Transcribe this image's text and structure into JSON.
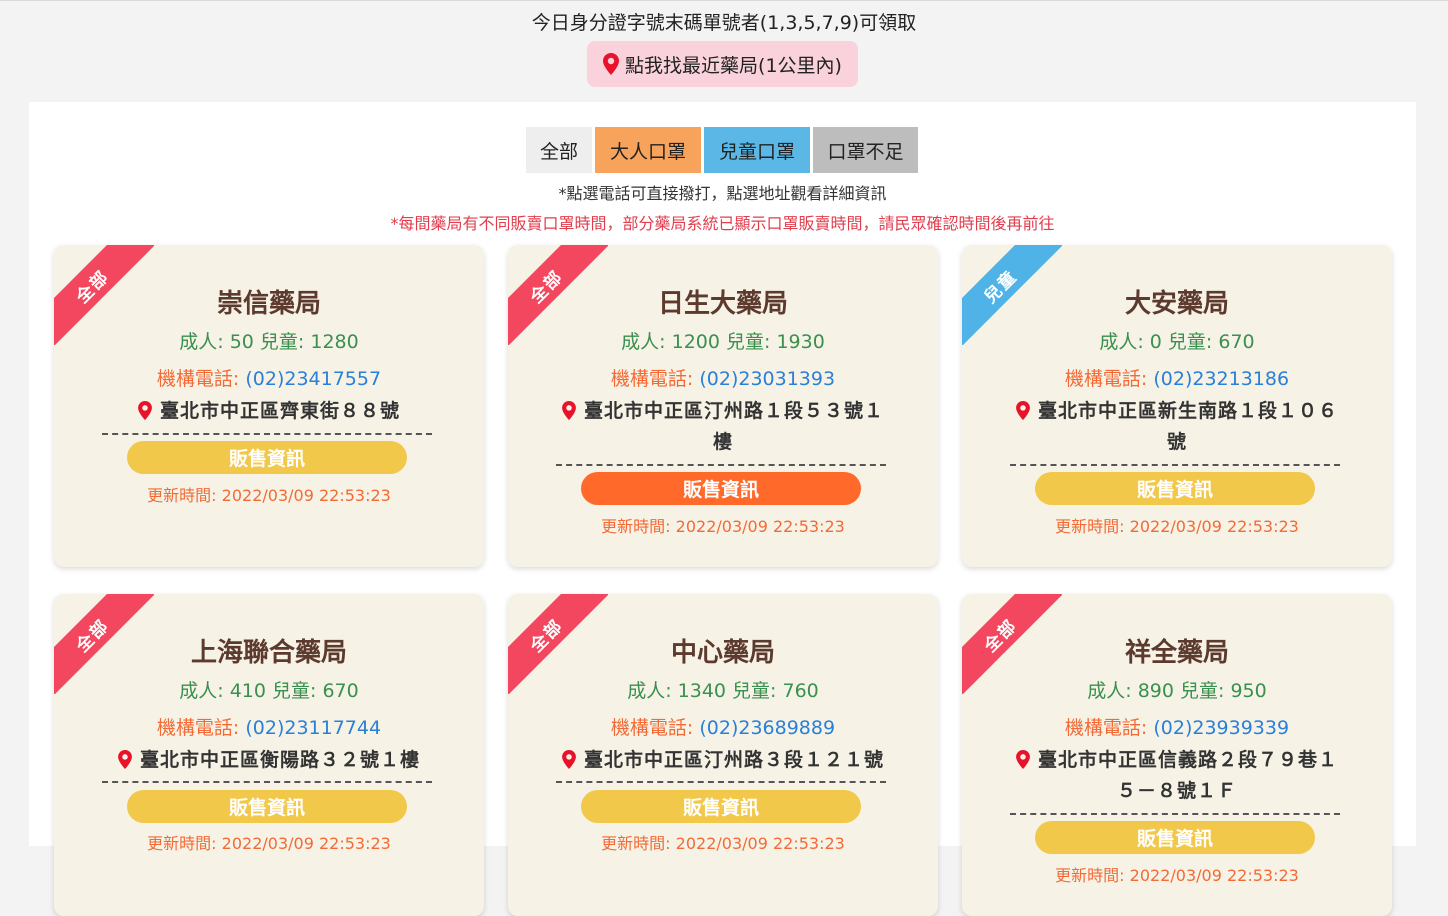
{
  "header": {
    "notice": "今日身分證字號末碼單號者(1,3,5,7,9)可領取",
    "locate_button": "點我找最近藥局(1公里內)"
  },
  "filters": [
    "全部",
    "大人口罩",
    "兒童口罩",
    "口罩不足"
  ],
  "hints": {
    "line1": "*點選電話可直接撥打，點選地址觀看詳細資訊",
    "line2": "*每間藥局有不同販賣口罩時間，部分藥局系統已顯示口罩販賣時間，請民眾確認時間後再前往"
  },
  "labels": {
    "phone_label": "機構電話: ",
    "sale_button": "販售資訊",
    "update_prefix": "更新時間: "
  },
  "colors": {
    "ribbon_all": "#f2475f",
    "ribbon_child": "#4fb3e8",
    "sale_yellow": "#f2c84b",
    "sale_orange": "#ff6a2b"
  },
  "pharmacies": [
    {
      "ribbon": "全部",
      "name": "崇信藥局",
      "stock": "成人: 50 兒童: 1280",
      "phone": "(02)23417557",
      "address": "臺北市中正區齊東街８８號",
      "updated": "更新時間: 2022/03/09 22:53:23"
    },
    {
      "ribbon": "全部",
      "name": "日生大藥局",
      "stock": "成人: 1200 兒童: 1930",
      "phone": "(02)23031393",
      "address": "臺北市中正區汀州路１段５３號１樓",
      "updated": "更新時間: 2022/03/09 22:53:23"
    },
    {
      "ribbon": "兒童",
      "name": "大安藥局",
      "stock": "成人: 0 兒童: 670",
      "phone": "(02)23213186",
      "address": "臺北市中正區新生南路１段１０６號",
      "updated": "更新時間: 2022/03/09 22:53:23"
    },
    {
      "ribbon": "全部",
      "name": "上海聯合藥局",
      "stock": "成人: 410 兒童: 670",
      "phone": "(02)23117744",
      "address": "臺北市中正區衡陽路３２號１樓",
      "updated": "更新時間: 2022/03/09 22:53:23"
    },
    {
      "ribbon": "全部",
      "name": "中心藥局",
      "stock": "成人: 1340 兒童: 760",
      "phone": "(02)23689889",
      "address": "臺北市中正區汀州路３段１２１號",
      "updated": "更新時間: 2022/03/09 22:53:23"
    },
    {
      "ribbon": "全部",
      "name": "祥全藥局",
      "stock": "成人: 890 兒童: 950",
      "phone": "(02)23939339",
      "address": "臺北市中正區信義路２段７９巷１５－８號１Ｆ",
      "updated": "更新時間: 2022/03/09 22:53:23"
    }
  ]
}
